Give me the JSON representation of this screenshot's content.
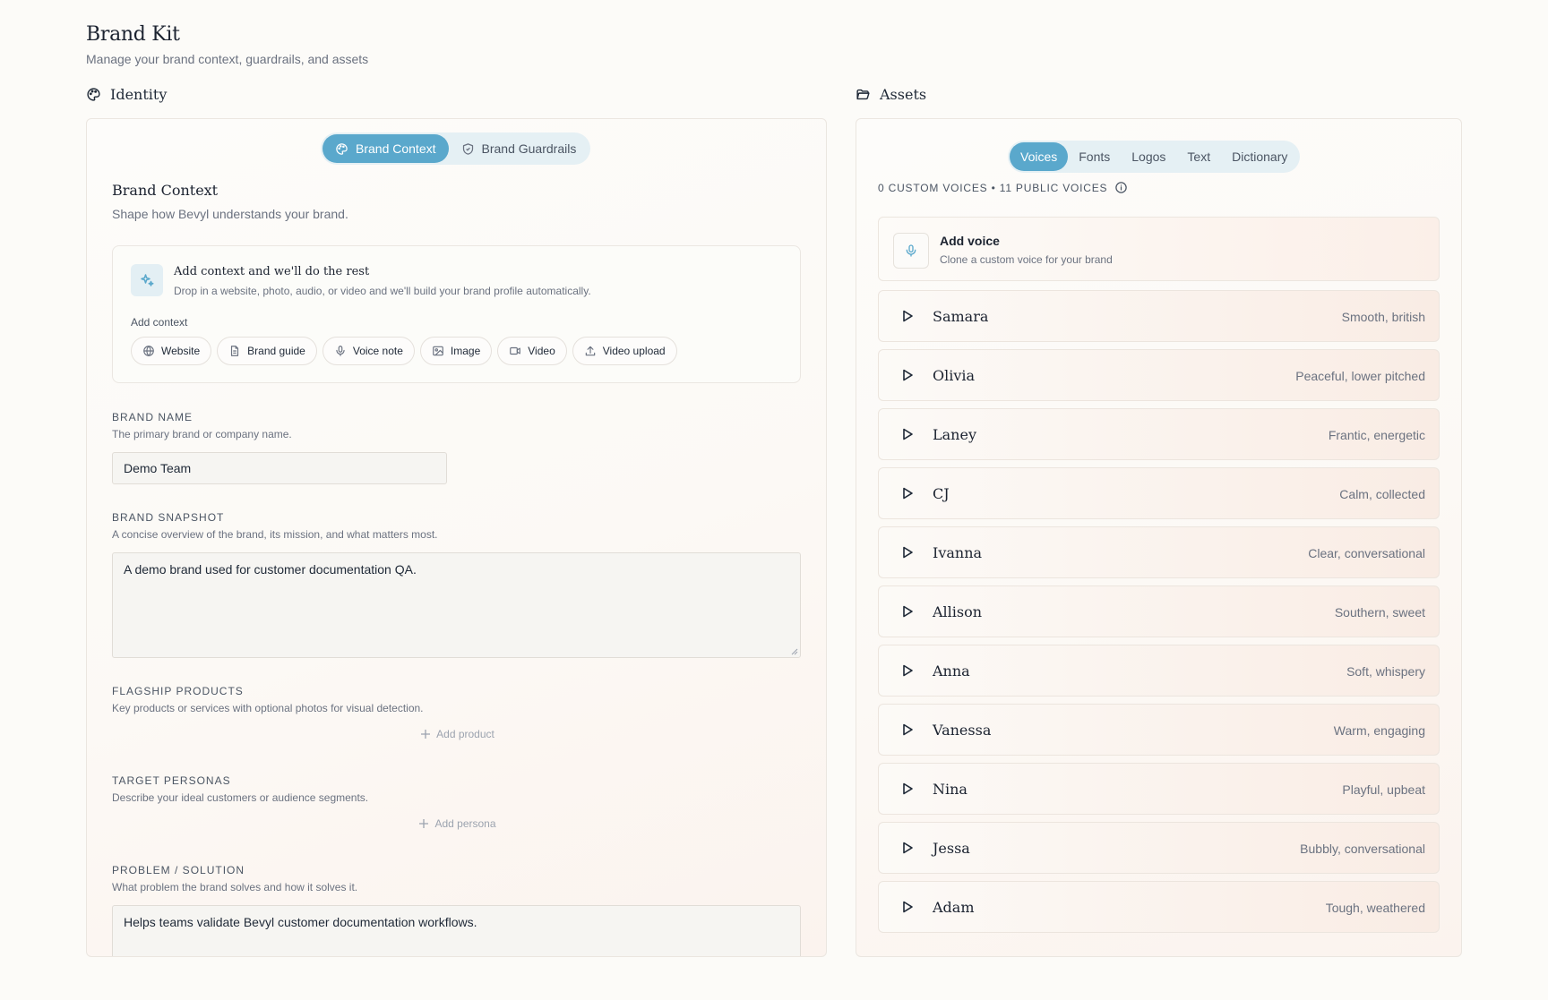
{
  "header": {
    "title": "Brand Kit",
    "subtitle": "Manage your brand context, guardrails, and assets"
  },
  "identity": {
    "section_title": "Identity",
    "tabs": [
      {
        "label": "Brand Context",
        "icon": "palette-icon",
        "active": true
      },
      {
        "label": "Brand Guardrails",
        "icon": "shield-icon",
        "active": false
      }
    ],
    "context_title": "Brand Context",
    "context_subtitle": "Shape how Bevyl understands your brand.",
    "add_card": {
      "title": "Add context and we'll do the rest",
      "subtitle": "Drop in a website, photo, audio, or video and we'll build your brand profile automatically.",
      "label": "Add context",
      "chips": [
        {
          "label": "Website",
          "icon": "globe-icon"
        },
        {
          "label": "Brand guide",
          "icon": "document-icon"
        },
        {
          "label": "Voice note",
          "icon": "microphone-icon"
        },
        {
          "label": "Image",
          "icon": "image-icon"
        },
        {
          "label": "Video",
          "icon": "video-icon"
        },
        {
          "label": "Video upload",
          "icon": "upload-icon"
        }
      ]
    },
    "brand_name": {
      "label": "BRAND NAME",
      "help": "The primary brand or company name.",
      "value": "Demo Team"
    },
    "brand_snapshot": {
      "label": "BRAND SNAPSHOT",
      "help": "A concise overview of the brand, its mission, and what matters most.",
      "value": "A demo brand used for customer documentation QA."
    },
    "flagship_products": {
      "label": "FLAGSHIP PRODUCTS",
      "help": "Key products or services with optional photos for visual detection.",
      "add_label": "Add product"
    },
    "target_personas": {
      "label": "TARGET PERSONAS",
      "help": "Describe your ideal customers or audience segments.",
      "add_label": "Add persona"
    },
    "problem_solution": {
      "label": "PROBLEM / SOLUTION",
      "help": "What problem the brand solves and how it solves it.",
      "value": "Helps teams validate Bevyl customer documentation workflows."
    }
  },
  "assets": {
    "section_title": "Assets",
    "tabs": [
      {
        "label": "Voices",
        "active": true
      },
      {
        "label": "Fonts",
        "active": false
      },
      {
        "label": "Logos",
        "active": false
      },
      {
        "label": "Text",
        "active": false
      },
      {
        "label": "Dictionary",
        "active": false
      }
    ],
    "voices_count": "0 CUSTOM VOICES • 11 PUBLIC VOICES",
    "add_voice": {
      "title": "Add voice",
      "subtitle": "Clone a custom voice for your brand"
    },
    "voices": [
      {
        "name": "Samara",
        "desc": "Smooth, british"
      },
      {
        "name": "Olivia",
        "desc": "Peaceful, lower pitched"
      },
      {
        "name": "Laney",
        "desc": "Frantic, energetic"
      },
      {
        "name": "CJ",
        "desc": "Calm, collected"
      },
      {
        "name": "Ivanna",
        "desc": "Clear, conversational"
      },
      {
        "name": "Allison",
        "desc": "Southern, sweet"
      },
      {
        "name": "Anna",
        "desc": "Soft, whispery"
      },
      {
        "name": "Vanessa",
        "desc": "Warm, engaging"
      },
      {
        "name": "Nina",
        "desc": "Playful, upbeat"
      },
      {
        "name": "Jessa",
        "desc": "Bubbly, conversational"
      },
      {
        "name": "Adam",
        "desc": "Tough, weathered"
      }
    ]
  },
  "colors": {
    "accent": "#5aa8cc",
    "tab_track": "#e5f0f4",
    "background": "#fcfbf8"
  }
}
